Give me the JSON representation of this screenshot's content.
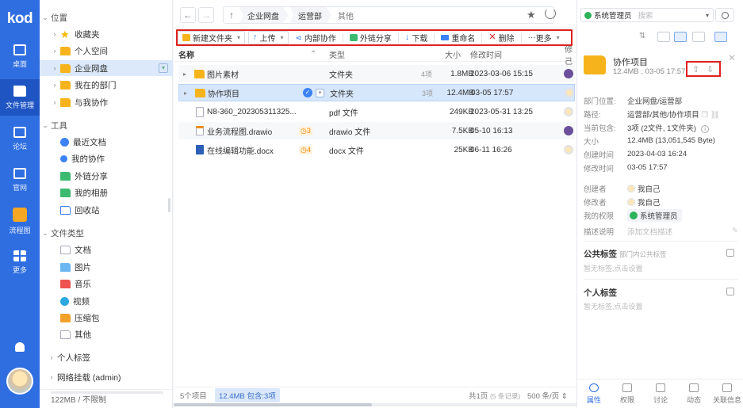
{
  "rail": {
    "logo": "kod",
    "items": [
      {
        "label": "桌面",
        "icon": "monitor-icon"
      },
      {
        "label": "文件管理",
        "icon": "folder-icon"
      },
      {
        "label": "论坛",
        "icon": "chat-icon"
      },
      {
        "label": "官网",
        "icon": "home-icon"
      },
      {
        "label": "流程图",
        "icon": "flowchart-icon"
      },
      {
        "label": "更多",
        "icon": "grid-icon"
      }
    ]
  },
  "tree": {
    "location_section": "位置",
    "items": [
      {
        "label": "收藏夹",
        "icon": "star-icon"
      },
      {
        "label": "个人空间",
        "icon": "home-folder-icon"
      },
      {
        "label": "企业网盘",
        "icon": "cloud-folder-icon"
      },
      {
        "label": "我在的部门",
        "icon": "folder-icon"
      },
      {
        "label": "与我协作",
        "icon": "folder-icon"
      }
    ],
    "tools_section": "工具",
    "tools": [
      {
        "label": "最近文档",
        "icon": "clock-icon"
      },
      {
        "label": "我的协作",
        "icon": "share-nodes-icon"
      },
      {
        "label": "外链分享",
        "icon": "link-icon"
      },
      {
        "label": "我的相册",
        "icon": "album-icon"
      },
      {
        "label": "回收站",
        "icon": "trash-icon"
      }
    ],
    "types_section": "文件类型",
    "types": [
      {
        "label": "文档",
        "icon": "doc-icon"
      },
      {
        "label": "图片",
        "icon": "image-icon"
      },
      {
        "label": "音乐",
        "icon": "music-icon"
      },
      {
        "label": "视频",
        "icon": "video-icon"
      },
      {
        "label": "压缩包",
        "icon": "zip-icon"
      },
      {
        "label": "其他",
        "icon": "file-icon"
      }
    ],
    "personal_tags": "个人标签",
    "network_mount": "网络挂载 (admin)",
    "quota": "122MB / 不限制"
  },
  "crumbs": [
    "企业网盘",
    "运营部",
    "其他"
  ],
  "toolbar": {
    "new_folder": "新建文件夹",
    "upload": "上传",
    "internal_collab": "内部协作",
    "external_share": "外链分享",
    "download": "下载",
    "rename": "重命名",
    "delete": "删除",
    "more": "更多"
  },
  "table": {
    "col_name": "名称",
    "col_type": "类型",
    "col_size": "大小",
    "col_mtime": "修改时间",
    "col_owner": "修己",
    "rows": [
      {
        "name": "图片素材",
        "count": "4项",
        "type": "文件夹",
        "size": "1.8MB",
        "mtime": "2023-03-06 15:15",
        "badge": ""
      },
      {
        "name": "协作项目",
        "count": "3项",
        "type": "文件夹",
        "size": "12.4MB",
        "mtime": "03-05 17:57",
        "badge": ""
      },
      {
        "name": "N8-360_202305311325...",
        "count": "",
        "type": "pdf 文件",
        "size": "249KB",
        "mtime": "2023-05-31 13:25",
        "badge": ""
      },
      {
        "name": "业务流程图.drawio",
        "count": "",
        "type": "drawio 文件",
        "size": "7.5KB",
        "mtime": "05-10 16:13",
        "badge": "3"
      },
      {
        "name": "在线编辑功能.docx",
        "count": "",
        "type": "docx 文件",
        "size": "25KB",
        "mtime": "06-11 16:26",
        "badge": "4"
      }
    ]
  },
  "footer": {
    "items_count": "5个项目",
    "selected": "12.4MB 包含:3项",
    "pages": "共1页",
    "records": "(5 条记录)",
    "per_page": "500 条/页"
  },
  "right": {
    "user": "系统管理员",
    "search_placeholder": "搜索",
    "title": "协作项目",
    "subtitle": "12.4MB , 03-05 17:57",
    "props": [
      {
        "k": "部门位置:",
        "v": "企业网盘/运营部"
      },
      {
        "k": "路径:",
        "v": "运营部/其他/协作项目"
      },
      {
        "k": "当前包含:",
        "v": "3项 (2文件, 1文件夹)"
      },
      {
        "k": "大小",
        "v": "12.4MB (13,051,545 Byte)"
      },
      {
        "k": "创建时间",
        "v": "2023-04-03 16:24"
      },
      {
        "k": "修改时间",
        "v": "03-05 17:57"
      }
    ],
    "props2": [
      {
        "k": "创建者",
        "v": "我自己"
      },
      {
        "k": "修改者",
        "v": "我自己"
      },
      {
        "k": "我的权限",
        "v": "系统管理员"
      },
      {
        "k": "描述说明",
        "v": "添加文档描述"
      }
    ],
    "public_tags": "公共标签",
    "public_tags_hint": "部门内公共标签",
    "public_tags_empty": "暂无标签,点击设置",
    "personal_tags": "个人标签",
    "personal_tags_empty": "暂无标签,点击设置",
    "tabs": [
      "属性",
      "权限",
      "讨论",
      "动态",
      "关联信息"
    ]
  }
}
